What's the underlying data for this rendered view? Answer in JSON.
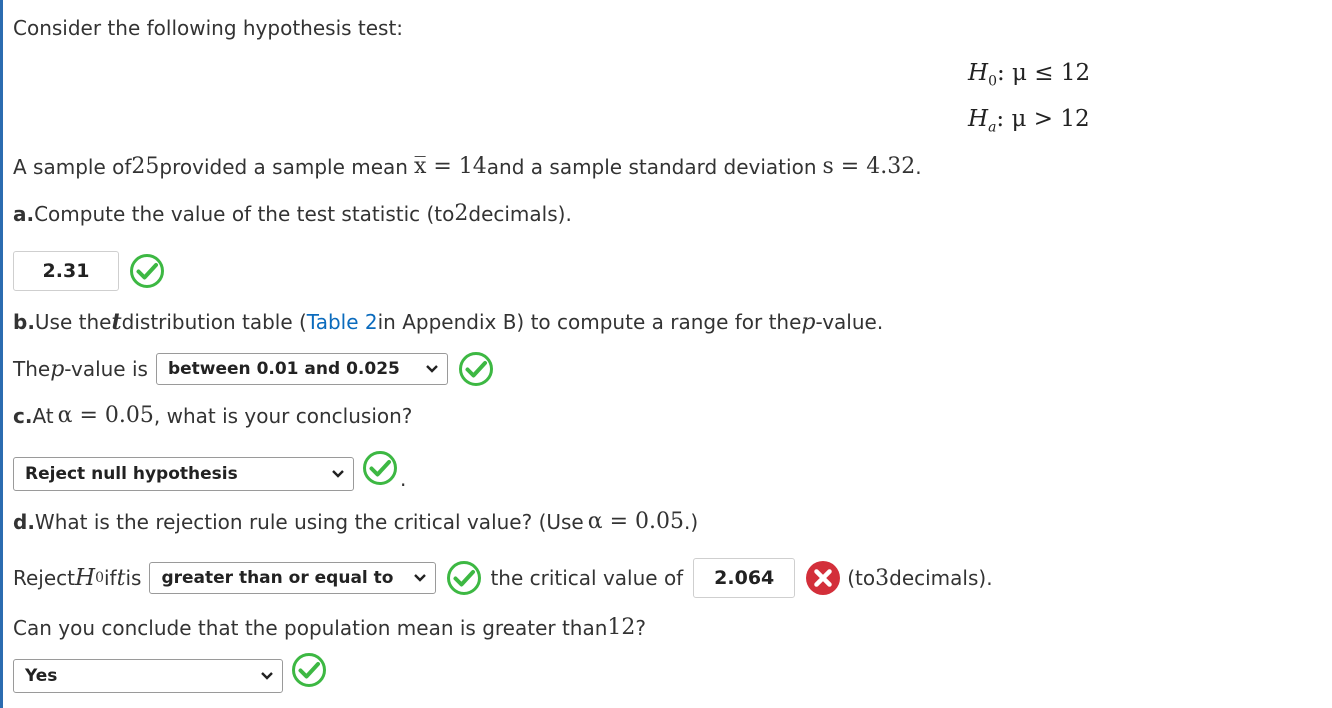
{
  "intro": {
    "text": "Consider the following hypothesis test:"
  },
  "hypotheses": {
    "h0": {
      "symbol": "H",
      "sub": "0",
      "rel": ": μ ≤ 12"
    },
    "ha": {
      "symbol": "H",
      "sub": "a",
      "rel": ": μ > 12"
    }
  },
  "sample": {
    "t1": "A sample of ",
    "n": "25",
    "t2": " provided a sample mean ",
    "xbar": "x̅ = 14",
    "t3": " and a sample standard deviation ",
    "s": "s = 4.32",
    "t4": "."
  },
  "part_a": {
    "label": "a.",
    "text": " Compute the value of the test statistic (to ",
    "num": "2",
    "end": " decimals).",
    "answer": "2.31",
    "status": "correct"
  },
  "part_b": {
    "label": "b.",
    "t1": " Use the ",
    "t_sym": "t",
    "t2": " distribution table (",
    "link": "Table 2",
    "t3": " in Appendix B) to compute a range for the ",
    "p_sym": "p",
    "t4": "-value.",
    "pv1": "The ",
    "pv2": "-value is",
    "select": "between 0.01 and 0.025",
    "status": "correct"
  },
  "part_c": {
    "label": "c.",
    "t1": " At ",
    "alpha": "α = 0.05",
    "t2": ", what is your conclusion?",
    "select": "Reject null hypothesis",
    "period": ".",
    "status": "correct"
  },
  "part_d": {
    "label": "d.",
    "t1": " What is the rejection rule using the critical value? (Use ",
    "alpha": "α = 0.05",
    "t2": ".)",
    "reject": "Reject ",
    "h": "H",
    "h_sub": "0",
    "if": " if ",
    "t_sym": "t",
    "is": " is",
    "select": "greater than or equal to",
    "select_status": "correct",
    "crit_text": "the critical value of",
    "crit_answer": "2.064",
    "crit_status": "incorrect",
    "crit_end1": "(to ",
    "crit_num": "3",
    "crit_end2": " decimals).",
    "q1": "Can you conclude that the population mean is greater than ",
    "q_num": "12",
    "q2": "?",
    "final_select": "Yes",
    "final_status": "correct"
  },
  "colors": {
    "correct": "#3db843",
    "incorrect": "#d32f3a",
    "link": "#0b6bbd",
    "border": "#2b6cb0"
  },
  "icons": {
    "correct": "check-circle-icon",
    "incorrect": "x-circle-icon",
    "chevron": "chevron-down-icon"
  }
}
